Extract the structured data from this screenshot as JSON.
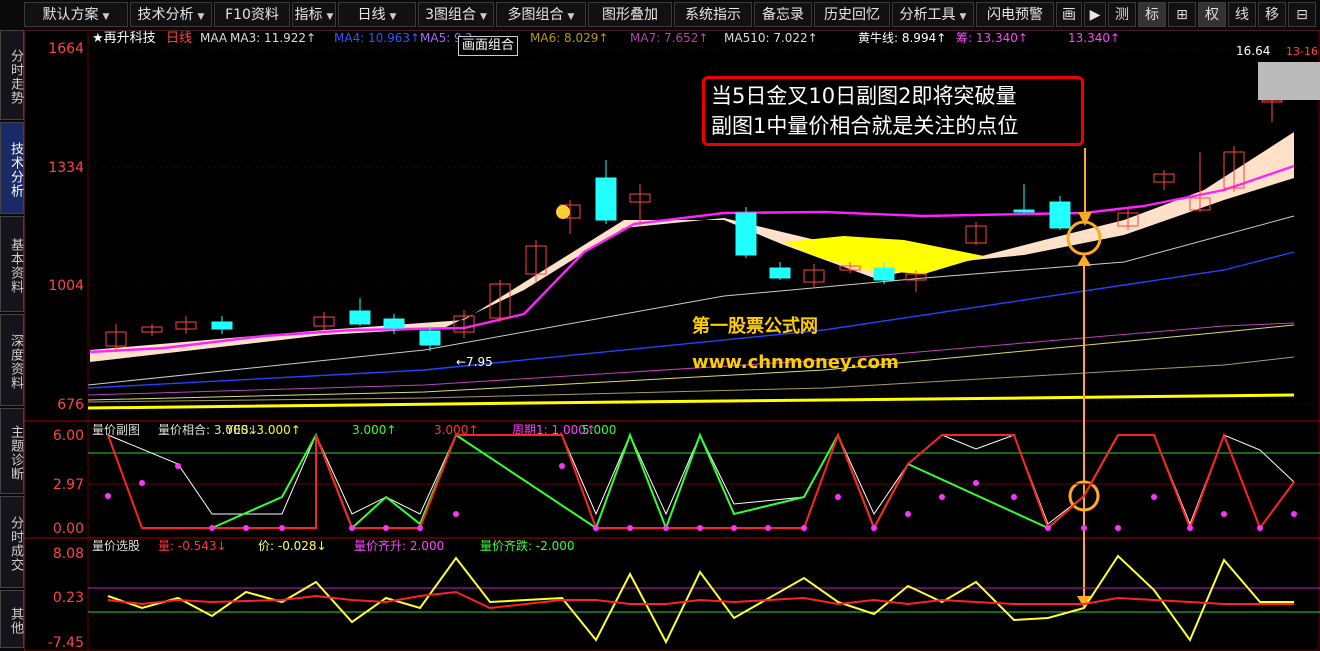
{
  "toolbar": {
    "items": [
      {
        "label": "默认方案",
        "dd": true
      },
      {
        "label": "技术分析",
        "dd": true
      },
      {
        "label": "F10资料",
        "dd": false
      },
      {
        "label": "指标",
        "dd": true
      },
      {
        "label": "日线",
        "dd": true
      },
      {
        "label": "3图组合",
        "dd": true
      },
      {
        "label": "多图组合",
        "dd": true
      },
      {
        "label": "图形叠加",
        "dd": false
      },
      {
        "label": "系统指示",
        "dd": false
      },
      {
        "label": "备忘录",
        "dd": false
      },
      {
        "label": "历史回忆",
        "dd": false
      },
      {
        "label": "分析工具",
        "dd": true
      },
      {
        "label": "闪电预警",
        "dd": false
      },
      {
        "label": "画",
        "dd": false
      }
    ],
    "right": [
      "测",
      "标",
      "⊞",
      "权",
      "线",
      "移",
      "⊟"
    ]
  },
  "sidebar": {
    "tabs": [
      "分时走势",
      "技术分析",
      "基本资料",
      "深度资料",
      "主题诊断",
      "分时成交",
      "其他"
    ]
  },
  "main": {
    "title": "★再升科技",
    "period": "日线",
    "legend": [
      {
        "text": "MAA",
        "color": "#dddddd"
      },
      {
        "text": "MA3: 11.922↑",
        "color": "#dddddd"
      },
      {
        "text": "MA4: 10.963↑",
        "color": "#3355ff"
      },
      {
        "text": "MA5: 9.?",
        "color": "#aa66ff"
      },
      {
        "text": "MA6: 8.029↑",
        "color": "#bb9900"
      },
      {
        "text": "MA7: 7.652↑",
        "color": "#bb44aa"
      },
      {
        "text": "MA510: 7.022↑",
        "color": "#dddddd"
      },
      {
        "text": "黄牛线: 8.994↑",
        "color": "#ffffff"
      },
      {
        "text": "筹: 13.340↑",
        "color": "#ff44ff"
      },
      {
        "text": "13.340↑",
        "color": "#ff44ff"
      }
    ],
    "y_ticks": [
      "1664",
      "1334",
      "1004",
      "676"
    ],
    "low_label": "←7.95",
    "high_label": "16.64",
    "high_label2": "13-16",
    "watermark1": "第一股票公式网",
    "watermark2": "www.chnmoney.com"
  },
  "tooltip": "画面组合",
  "callout": {
    "line1": "当5日金叉10日副图2即将突破量",
    "line2": "副图1中量价相合就是关注的点位"
  },
  "sub1": {
    "legend": [
      {
        "text": "量价副图",
        "color": "#dddddd"
      },
      {
        "text": "量价相合: 3.000↓",
        "color": "#dddddd"
      },
      {
        "text": "YES: 3.000↑",
        "color": "#ffff00"
      },
      {
        "text": "3.000↑",
        "color": "#33ff33"
      },
      {
        "text": "3.000↑",
        "color": "#ff3333"
      },
      {
        "text": "周期1: 1.000↑",
        "color": "#ff44ff"
      },
      {
        "text": "5.000",
        "color": "#33ff33"
      }
    ],
    "y_ticks": [
      "6.00",
      "2.97",
      "0.00"
    ]
  },
  "sub2": {
    "legend": [
      {
        "text": "量价选股",
        "color": "#dddddd"
      },
      {
        "text": "量: -0.543↓",
        "color": "#ff3333"
      },
      {
        "text": "价: -0.028↓",
        "color": "#ffff66"
      },
      {
        "text": "量价齐升: 2.000",
        "color": "#ff44ff"
      },
      {
        "text": "量价齐跌: -2.000",
        "color": "#33ff33"
      }
    ],
    "y_ticks": [
      "8.08",
      "0.23",
      "-7.45"
    ]
  },
  "colors": {
    "ma_magenta": "#ff22ff",
    "band": "#ffe0c8",
    "yellow_fill": "#ffff00",
    "up": "#ff4444",
    "down": "#22ffff",
    "ma_blue": "#2244ff",
    "grid": "#880000"
  }
}
